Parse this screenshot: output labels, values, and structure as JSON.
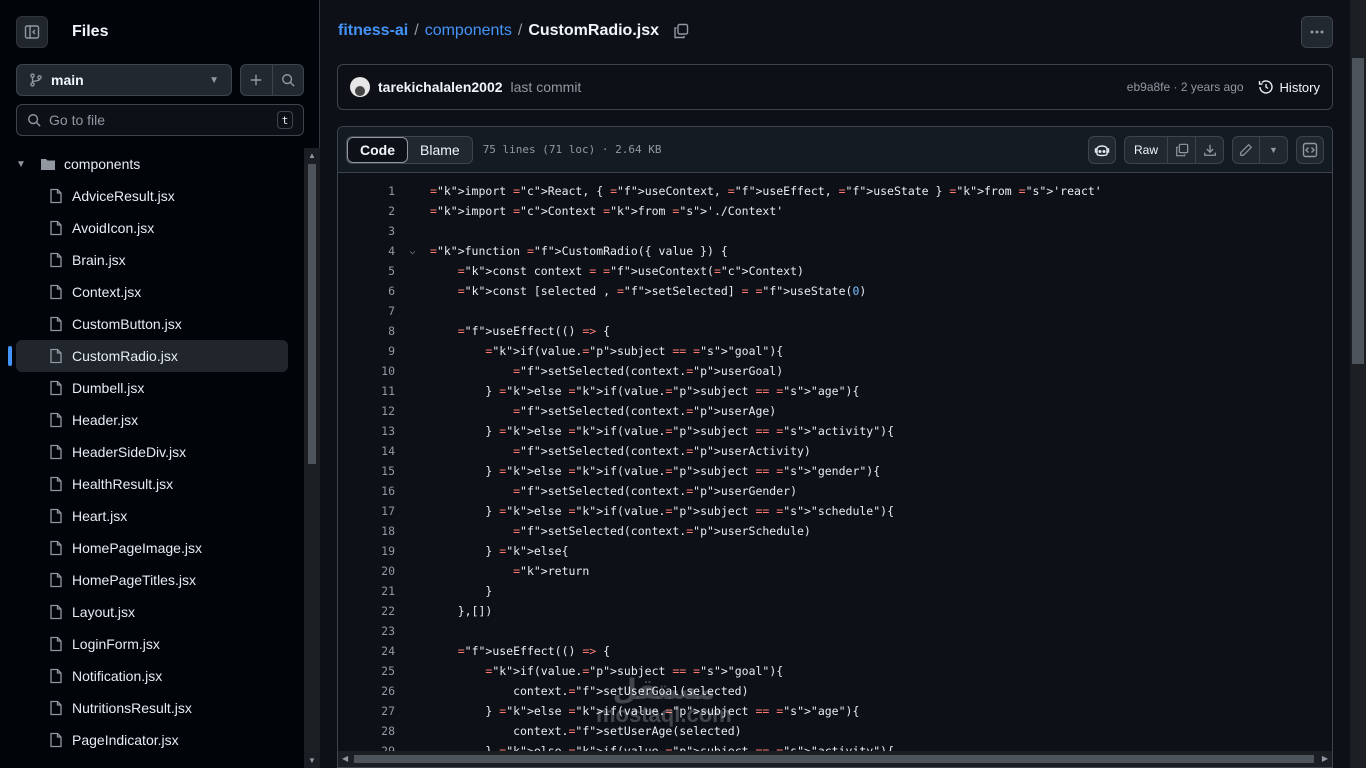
{
  "sidebar": {
    "title": "Files",
    "branch": "main",
    "search_placeholder": "Go to file",
    "search_shortcut": "t",
    "folder": "components",
    "files": [
      "AdviceResult.jsx",
      "AvoidIcon.jsx",
      "Brain.jsx",
      "Context.jsx",
      "CustomButton.jsx",
      "CustomRadio.jsx",
      "Dumbell.jsx",
      "Header.jsx",
      "HeaderSideDiv.jsx",
      "HealthResult.jsx",
      "Heart.jsx",
      "HomePageImage.jsx",
      "HomePageTitles.jsx",
      "Layout.jsx",
      "LoginForm.jsx",
      "Notification.jsx",
      "NutritionsResult.jsx",
      "PageIndicator.jsx"
    ],
    "active_file": "CustomRadio.jsx"
  },
  "breadcrumb": {
    "repo": "fitness-ai",
    "folder": "components",
    "file": "CustomRadio.jsx",
    "sep": "/"
  },
  "commit": {
    "author": "tarekichalalen2002",
    "message": "last commit",
    "meta": "eb9a8fe · 2 years ago",
    "history_label": "History"
  },
  "file_header": {
    "tab_code": "Code",
    "tab_blame": "Blame",
    "info": "75 lines (71 loc) · 2.64 KB",
    "raw_label": "Raw"
  },
  "code_lines": [
    "import React, { useContext, useEffect, useState } from 'react'",
    "import Context from './Context'",
    "",
    "function CustomRadio({ value }) {",
    "    const context = useContext(Context)",
    "    const [selected , setSelected] = useState(0)",
    "",
    "    useEffect(() => {",
    "        if(value.subject == \"goal\"){",
    "            setSelected(context.userGoal)",
    "        } else if(value.subject == \"age\"){",
    "            setSelected(context.userAge)",
    "        } else if(value.subject == \"activity\"){",
    "            setSelected(context.userActivity)",
    "        } else if(value.subject == \"gender\"){",
    "            setSelected(context.userGender)",
    "        } else if(value.subject == \"schedule\"){",
    "            setSelected(context.userSchedule)",
    "        } else{",
    "            return",
    "        }",
    "    },[])",
    "",
    "    useEffect(() => {",
    "        if(value.subject == \"goal\"){",
    "            context.setUserGoal(selected)",
    "        } else if(value.subject == \"age\"){",
    "            context.setUserAge(selected)",
    "        } else if(value.subject == \"activity\"){"
  ],
  "watermark": {
    "line1": "مستقل",
    "line2": "mostaql.com"
  },
  "colors": {
    "accent": "#4493f8",
    "keyword": "#ff7b72",
    "function": "#d2a8ff",
    "string": "#a5d6ff",
    "property": "#79c0ff",
    "entity": "#ffa657"
  }
}
